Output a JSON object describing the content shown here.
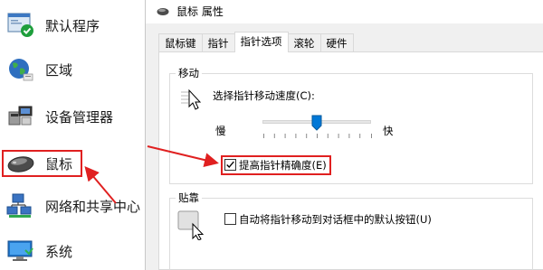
{
  "control_panel": {
    "items": [
      {
        "label": "默认程序",
        "icon": "default-programs-icon"
      },
      {
        "label": "区域",
        "icon": "region-globe-icon"
      },
      {
        "label": "设备管理器",
        "icon": "device-manager-icon"
      },
      {
        "label": "鼠标",
        "icon": "mouse-icon"
      },
      {
        "label": "网络和共享中心",
        "icon": "network-sharing-icon"
      },
      {
        "label": "系统",
        "icon": "system-icon"
      }
    ]
  },
  "dialog": {
    "title": "鼠标 属性",
    "tabs": [
      {
        "label": "鼠标键"
      },
      {
        "label": "指针"
      },
      {
        "label": "指针选项",
        "active": true
      },
      {
        "label": "滚轮"
      },
      {
        "label": "硬件"
      }
    ],
    "motion": {
      "group_title": "移动",
      "speed_label": "选择指针移动速度(C):",
      "slow_label": "慢",
      "fast_label": "快",
      "speed_level": 0.5,
      "precision_label": "提高指针精确度(E)",
      "precision_checked": true
    },
    "snap": {
      "group_title": "贴靠",
      "snap_label": "自动将指针移动到对话框中的默认按钮(U)",
      "snap_checked": false
    }
  },
  "annotation_color": "#e02020"
}
